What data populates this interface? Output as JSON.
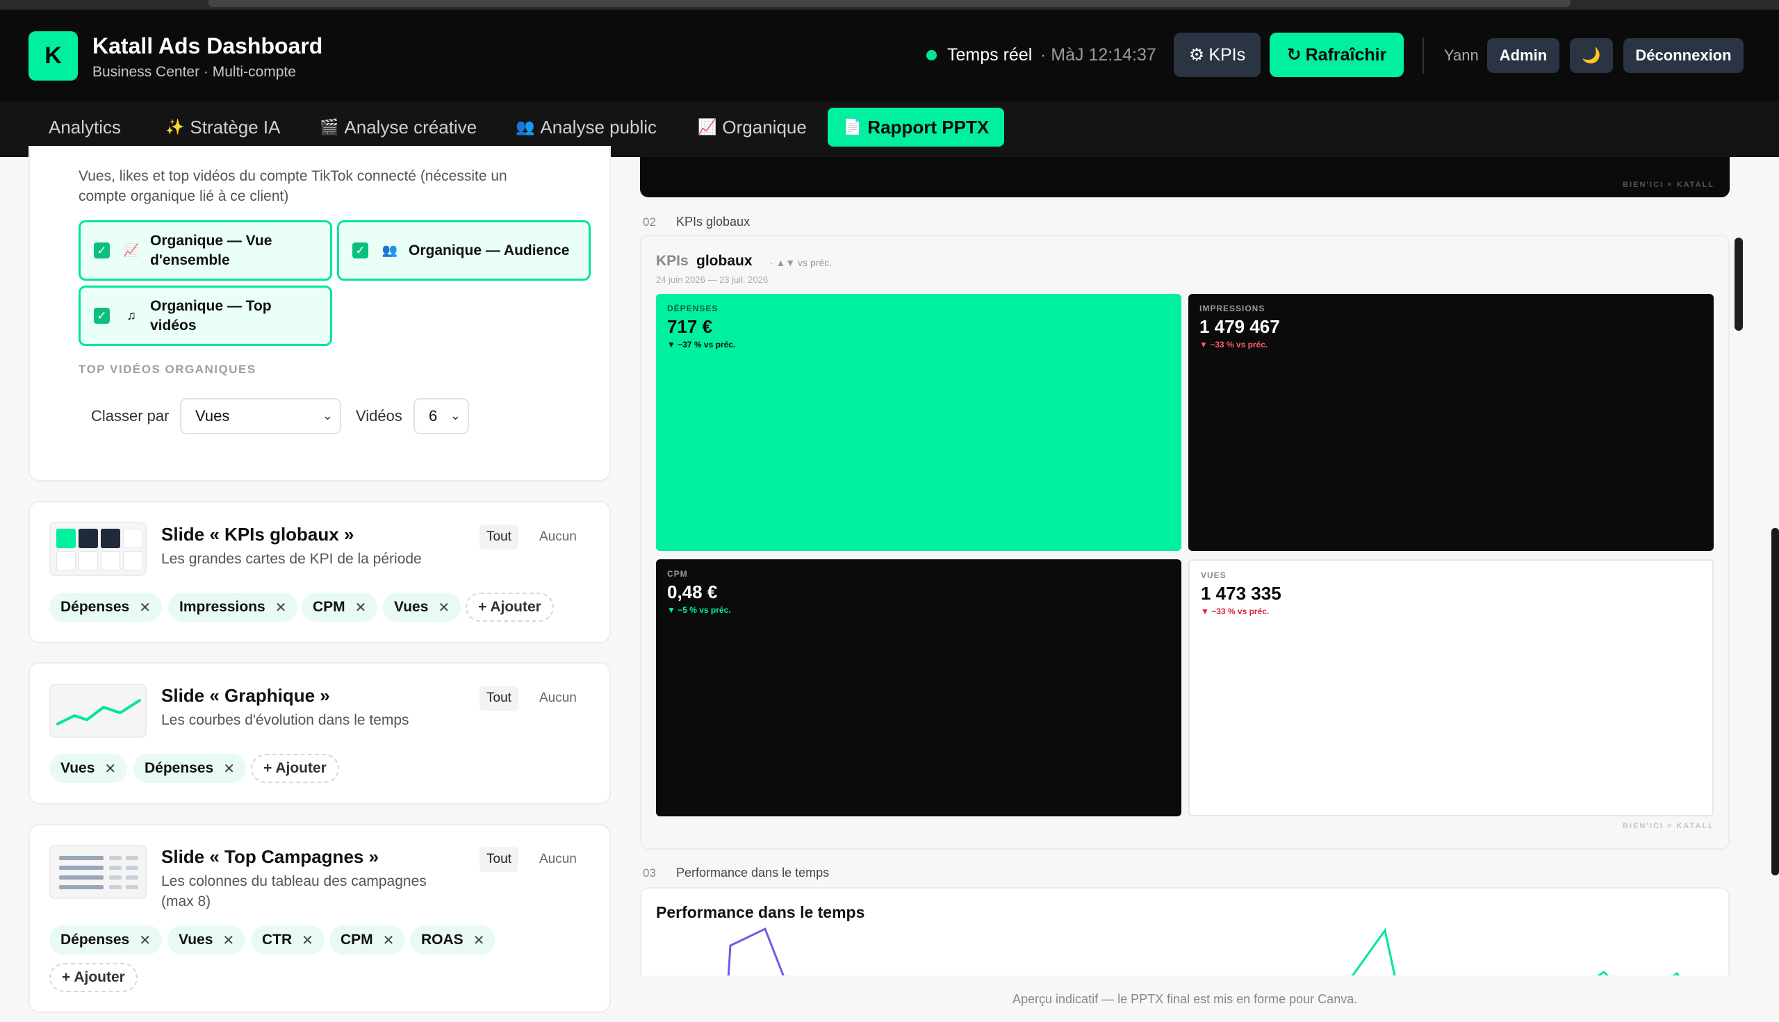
{
  "header": {
    "logo_letter": "K",
    "title": "Katall Ads Dashboard",
    "subtitle": "Business Center · Multi-compte",
    "status": "Temps réel",
    "updated": "· MàJ 12:14:37",
    "kpis_btn": "KPIs",
    "refresh_btn": "Rafraîchir",
    "user": "Yann",
    "role_btn": "Admin",
    "moon": "🌙",
    "logout_btn": "Déconnexion"
  },
  "nav": {
    "tabs": [
      {
        "label": "Analytics",
        "icon": ""
      },
      {
        "label": "Stratège IA",
        "icon": "✨"
      },
      {
        "label": "Analyse créative",
        "icon": "🎬"
      },
      {
        "label": "Analyse public",
        "icon": "👥"
      },
      {
        "label": "Organique",
        "icon": "📈"
      },
      {
        "label": "Rapport PPTX",
        "icon": "📄"
      }
    ],
    "active": "Rapport PPTX"
  },
  "organic": {
    "description": "Vues, likes et top vidéos du compte TikTok connecté (nécessite un compte organique lié à ce client)",
    "options": [
      {
        "label": "Organique — Vue d'ensemble",
        "icon": "📈",
        "checked": true
      },
      {
        "label": "Organique — Audience",
        "icon": "👥",
        "checked": true
      },
      {
        "label": "Organique — Top vidéos",
        "icon": "♫",
        "checked": true
      }
    ],
    "section_caption": "TOP VIDÉOS ORGANIQUES",
    "sort_label": "Classer par",
    "sort_value": "Vues",
    "videos_label": "Vidéos",
    "videos_value": "6"
  },
  "slides": {
    "all_label": "Tout",
    "none_label": "Aucun",
    "add_label": "+ Ajouter",
    "kpis": {
      "title": "Slide « KPIs globaux »",
      "desc": "Les grandes cartes de KPI de la période",
      "chips": [
        "Dépenses",
        "Impressions",
        "CPM",
        "Vues"
      ]
    },
    "graph": {
      "title": "Slide « Graphique »",
      "desc": "Les courbes d'évolution dans le temps",
      "chips": [
        "Vues",
        "Dépenses"
      ]
    },
    "top": {
      "title": "Slide « Top Campagnes »",
      "desc": "Les colonnes du tableau des campagnes (max 8)",
      "chips": [
        "Dépenses",
        "Vues",
        "CTR",
        "CPM",
        "ROAS"
      ]
    }
  },
  "preview": {
    "watermark": "BIEN'ICI × KATALL",
    "section2_num": "02",
    "section2_label": "KPIs globaux",
    "kpi_head_light": "KPIs",
    "kpi_head_bold": "globaux",
    "kpi_head_note": "· ▲▼ vs préc.",
    "kpi_range": "24 juin 2026 — 23 juil. 2026",
    "tiles": [
      {
        "label": "DÉPENSES",
        "value": "717 €",
        "delta": "▼ −37 % vs préc."
      },
      {
        "label": "IMPRESSIONS",
        "value": "1 479 467",
        "delta": "▼ −33 % vs préc."
      },
      {
        "label": "CPM",
        "value": "0,48 €",
        "delta": "▼ −5 % vs préc."
      },
      {
        "label": "VUES",
        "value": "1 473 335",
        "delta": "▼ −33 % vs préc."
      }
    ],
    "section3_num": "03",
    "section3_label": "Performance dans le temps",
    "perf_title": "Performance dans le temps",
    "footer_note": "Aperçu indicatif — le PPTX final est mis en forme pour Canva."
  },
  "colors": {
    "accent": "#00f0a0",
    "dark": "#0b0b0c",
    "delta_red": "#e0364a",
    "delta_green": "#0b8f5e"
  }
}
